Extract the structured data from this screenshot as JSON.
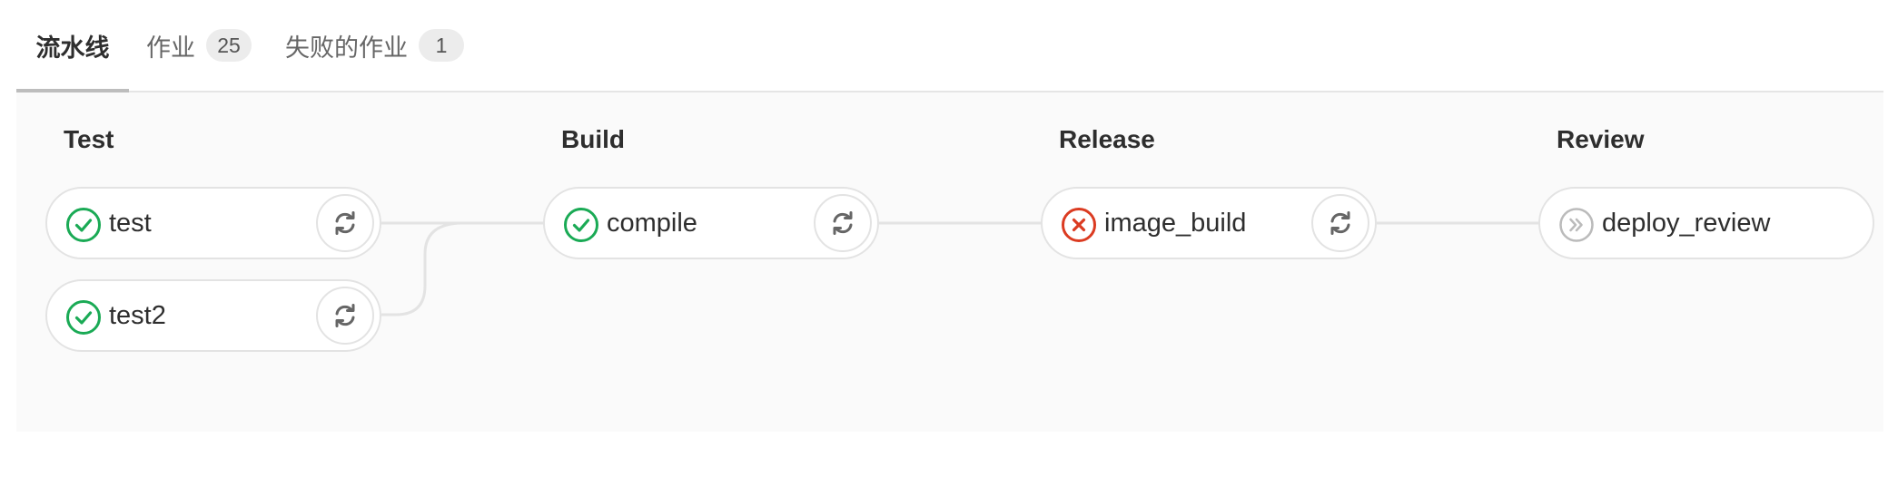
{
  "tabs": [
    {
      "label": "流水线"
    },
    {
      "label": "作业",
      "count": "25"
    },
    {
      "label": "失败的作业",
      "count": "1"
    }
  ],
  "stages": [
    {
      "title": "Test",
      "jobs": [
        {
          "name": "test",
          "status": "success",
          "status_icon": "check-circle-icon",
          "action_icon": "retry-icon"
        },
        {
          "name": "test2",
          "status": "success",
          "status_icon": "check-circle-icon",
          "action_icon": "retry-icon"
        }
      ]
    },
    {
      "title": "Build",
      "jobs": [
        {
          "name": "compile",
          "status": "success",
          "status_icon": "check-circle-icon",
          "action_icon": "retry-icon"
        }
      ]
    },
    {
      "title": "Release",
      "jobs": [
        {
          "name": "image_build",
          "status": "failed",
          "status_icon": "x-circle-icon",
          "action_icon": "retry-icon"
        }
      ]
    },
    {
      "title": "Review",
      "jobs": [
        {
          "name": "deploy_review",
          "status": "skipped",
          "status_icon": "skipped-icon"
        }
      ]
    }
  ],
  "colors": {
    "success": "#1aaa55",
    "failed": "#db3b21",
    "skipped": "#bbbbbb",
    "connector": "#e3e3e3",
    "icon": "#666666"
  }
}
